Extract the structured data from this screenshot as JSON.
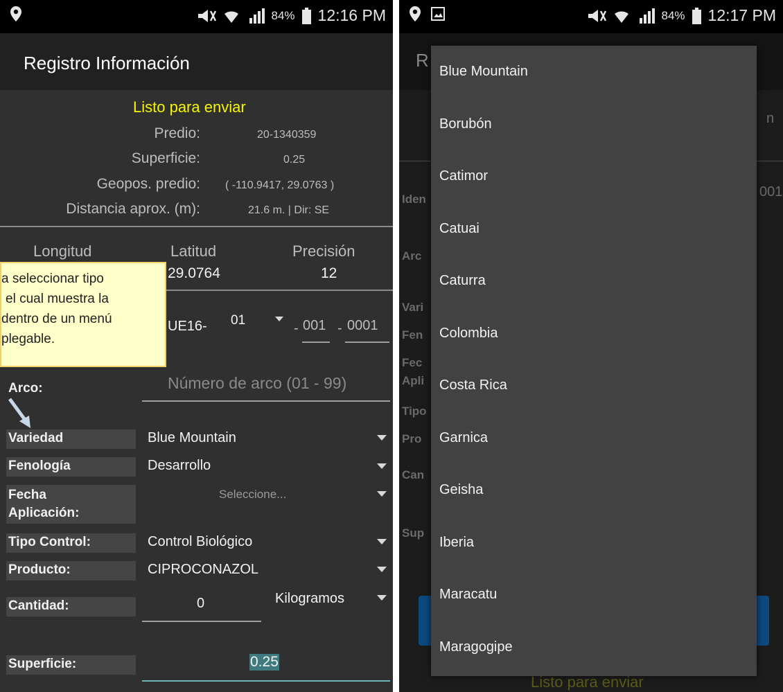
{
  "left": {
    "status": {
      "battery": "84%",
      "time": "12:16 PM"
    },
    "title": "Registro Información",
    "ready": "Listo para enviar",
    "info": [
      {
        "label": "Predio:",
        "value": "20-1340359"
      },
      {
        "label": "Superficie:",
        "value": "0.25"
      },
      {
        "label": "Geopos. predio:",
        "value": "( -110.9417, 29.0763 )"
      },
      {
        "label": "Distancia aprox. (m):",
        "value": "21.6 m. | Dir: SE"
      }
    ],
    "coords": {
      "h1": "Longitud",
      "h2": "Latitud",
      "h3": "Precisión",
      "v2": "29.0764",
      "v3": "12"
    },
    "ident": {
      "prefix": "UE16-",
      "sel": "01",
      "p2": "001",
      "p3": "0001"
    },
    "callout": {
      "l1": "a seleccionar tipo",
      "l2": "el cual muestra la",
      "l3": "dentro de un menú",
      "l4": "plegable."
    },
    "arco": {
      "label": "Arco:",
      "placeholder": "Número de arco (01 - 99)"
    },
    "fields": {
      "variedad": {
        "label": "Variedad",
        "value": "Blue Mountain"
      },
      "fenologia": {
        "label": "Fenología",
        "value": "Desarrollo"
      },
      "fecha": {
        "label1": "Fecha",
        "label2": "Aplicación:",
        "value": "Seleccione..."
      },
      "tipo": {
        "label": "Tipo Control:",
        "value": "Control Biológico"
      },
      "producto": {
        "label": "Producto:",
        "value": "CIPROCONAZOL"
      },
      "cantidad": {
        "label": "Cantidad:",
        "value": "0",
        "unit": "Kilogramos"
      },
      "superficie": {
        "label": "Superficie:",
        "value": "0.25"
      }
    }
  },
  "right": {
    "status": {
      "battery": "84%",
      "time": "12:17 PM"
    },
    "bg": {
      "title_initial": "R",
      "bg_right1": "n",
      "bg_right2": "001",
      "iden": "Iden",
      "arc": "Arc",
      "vari": "Vari",
      "fen": "Fen",
      "fec": "Fec",
      "apli": "Apli",
      "tipo": "Tipo",
      "pro": "Pro",
      "can": "Can",
      "sup": "Sup",
      "bottom": "Listo para enviar"
    },
    "menu": [
      "Blue Mountain",
      "Borubón",
      "Catimor",
      "Catuai",
      "Caturra",
      "Colombia",
      "Costa Rica",
      "Garnica",
      "Geisha",
      "Iberia",
      "Maracatu",
      "Maragogipe"
    ]
  }
}
